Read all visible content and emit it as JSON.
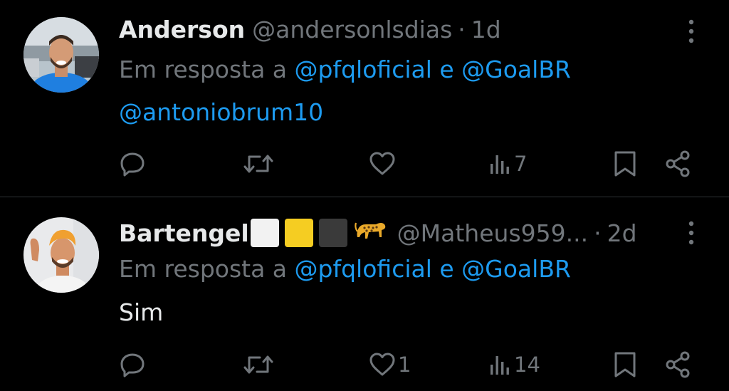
{
  "tweets": [
    {
      "display_name": "Anderson",
      "handle": "@andersonlsdias",
      "separator": "·",
      "time": "1d",
      "reply_prefix": "Em resposta a",
      "reply_mentions": "@pfqloficial e @GoalBR",
      "text": "@antoniobrum10",
      "stats": {
        "replies": "",
        "retweets": "",
        "likes": "",
        "views": "7"
      }
    },
    {
      "display_name": "Bartengel",
      "badges": [
        "white-square",
        "yellow-square",
        "black-square",
        "leopard-emoji"
      ],
      "handle": "@Matheus959...",
      "separator": "·",
      "time": "2d",
      "reply_prefix": "Em resposta a",
      "reply_mentions": "@pfqloficial e @GoalBR",
      "text": "Sim",
      "stats": {
        "replies": "",
        "retweets": "",
        "likes": "1",
        "views": "14"
      }
    }
  ],
  "colors": {
    "background": "#000000",
    "primary_text": "#e7e9ea",
    "secondary_text": "#71767b",
    "accent": "#1d9bf0",
    "divider": "#2f3336"
  },
  "icons": [
    "more-icon",
    "reply-icon",
    "retweet-icon",
    "like-icon",
    "views-icon",
    "bookmark-icon",
    "share-icon"
  ]
}
